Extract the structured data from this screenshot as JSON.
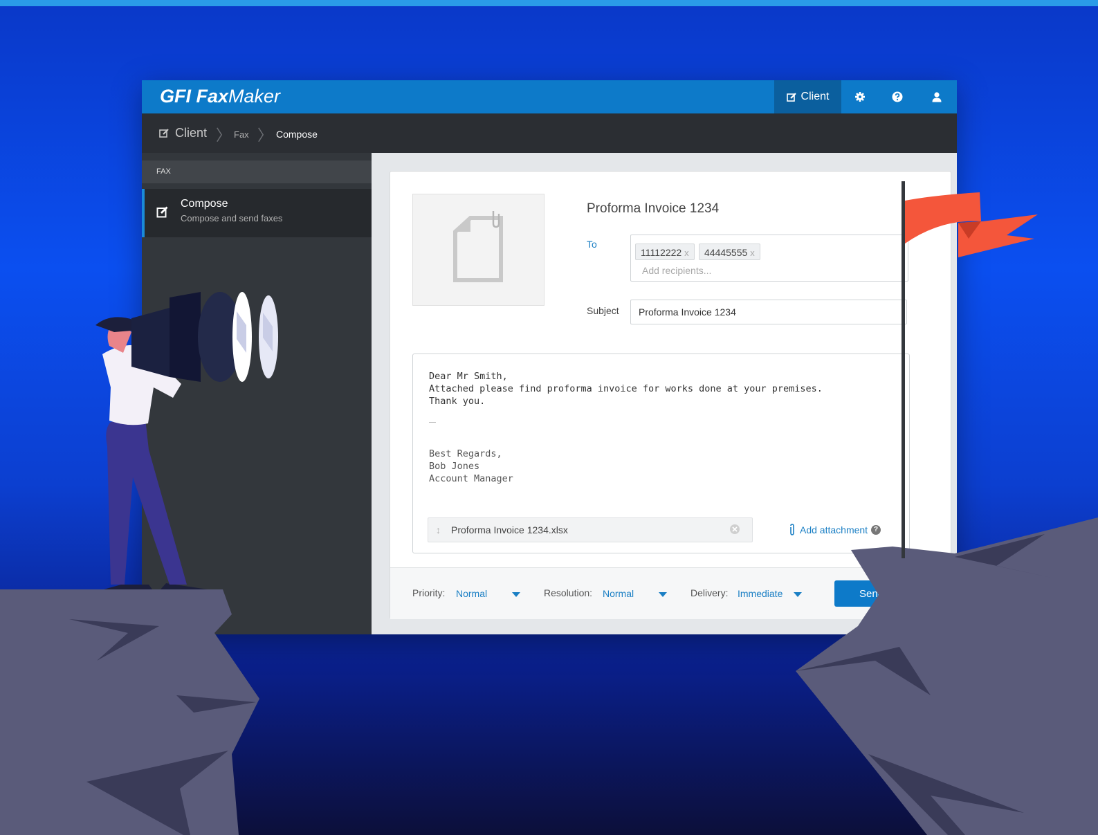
{
  "app": {
    "brand_bold": "GFI Fax",
    "brand_light": "Maker",
    "header": {
      "client_label": "Client",
      "icons": [
        "edit-icon",
        "gear-icon",
        "help-icon",
        "user-icon"
      ]
    },
    "breadcrumb": [
      "Client",
      "Fax",
      "Compose"
    ]
  },
  "sidebar": {
    "section_label": "FAX",
    "items": [
      {
        "label": "Compose",
        "sublabel": "Compose and send faxes",
        "active": true
      }
    ]
  },
  "compose": {
    "title": "Proforma Invoice 1234",
    "to_label": "To",
    "recipients": [
      "11112222",
      "44445555"
    ],
    "recipient_remove_glyph": "x",
    "to_placeholder": "Add recipients...",
    "subject_label": "Subject",
    "subject_value": "Proforma Invoice 1234",
    "body_lines": "Dear Mr Smith,\nAttached please find proforma invoice for works done at your premises.\nThank you.",
    "signature_lines": "Best Regards,\nBob Jones\nAccount Manager",
    "attachment_name": "Proforma Invoice 1234.xlsx",
    "add_attachment_label": "Add attachment",
    "help_glyph": "?"
  },
  "footer": {
    "priority_label": "Priority:",
    "priority_value": "Normal",
    "resolution_label": "Resolution:",
    "resolution_value": "Normal",
    "delivery_label": "Delivery:",
    "delivery_value": "Immediate",
    "send_label": "Send"
  },
  "colors": {
    "header_blue": "#0d7ac9",
    "accent_blue": "#1a7fc4",
    "flag_red": "#f4563b",
    "rock": "#5a5b7a"
  }
}
